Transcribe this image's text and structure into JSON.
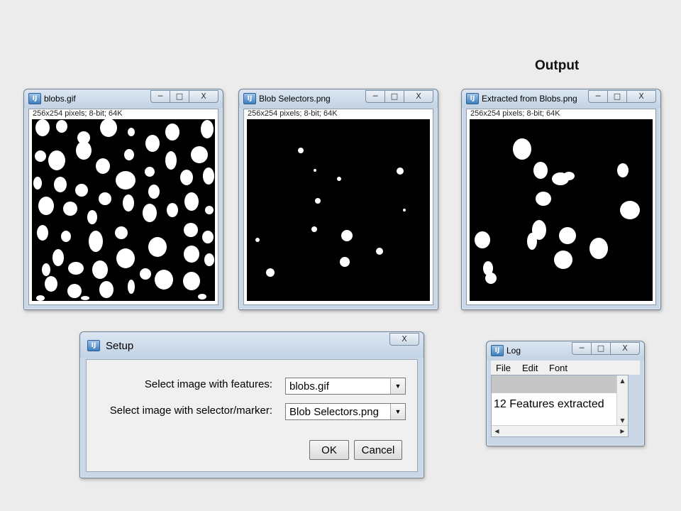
{
  "heading": {
    "output_label": "Output"
  },
  "windows": {
    "blobs": {
      "title": "blobs.gif",
      "info": "256x254 pixels; 8-bit; 64K"
    },
    "selectors": {
      "title": "Blob Selectors.png",
      "info": "256x254 pixels; 8-bit; 64K"
    },
    "extracted": {
      "title": "Extracted from Blobs.png",
      "info": "256x254 pixels; 8-bit; 64K"
    }
  },
  "window_controls": {
    "minimize": "─",
    "maximize": "□",
    "close": "X"
  },
  "setup": {
    "title": "Setup",
    "features_label": "Select image with features:",
    "features_value": "blobs.gif",
    "selector_label": "Select image with selector/marker:",
    "selector_value": "Blob Selectors.png",
    "ok_label": "OK",
    "cancel_label": "Cancel"
  },
  "log": {
    "title": "Log",
    "menu": [
      "File",
      "Edit",
      "Font"
    ],
    "line": "12 Features extracted"
  }
}
